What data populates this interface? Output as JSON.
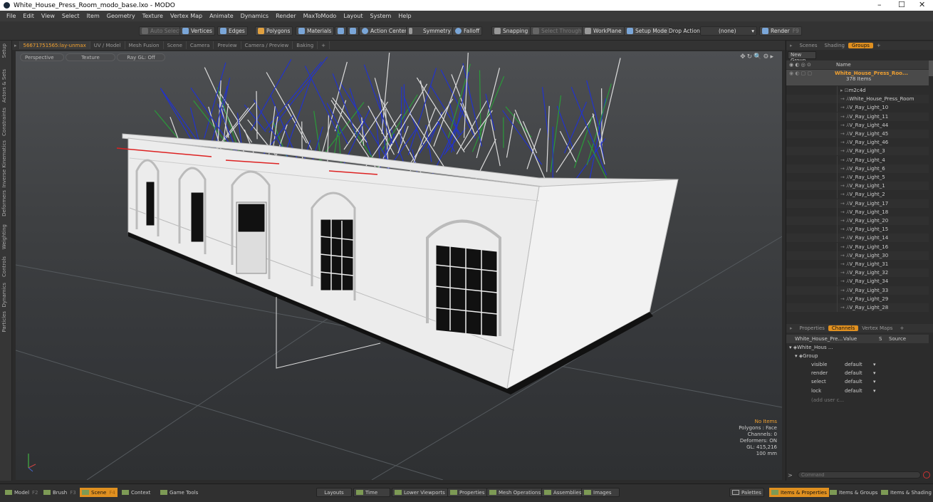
{
  "window": {
    "title": "White_House_Press_Room_modo_base.lxo - MODO",
    "minimize": "–",
    "maximize": "☐",
    "close": "✕"
  },
  "menu": [
    "File",
    "Edit",
    "View",
    "Select",
    "Item",
    "Geometry",
    "Texture",
    "Vertex Map",
    "Animate",
    "Dynamics",
    "Render",
    "MaxToModo",
    "Layout",
    "System",
    "Help"
  ],
  "toolbar": {
    "auto_select": "Auto Select",
    "vertices": "Vertices",
    "edges": "Edges",
    "polygons": "Polygons",
    "materials": "Materials",
    "action_center": "Action Center",
    "symmetry": "Symmetry",
    "falloff": "Falloff",
    "snapping": "Snapping",
    "select_through": "Select Through",
    "workplane": "WorkPlane",
    "setup_mode": "Setup Mode",
    "drop_action": "Drop Action",
    "drop_value": "(none)",
    "render": "Render",
    "render_key": "F9"
  },
  "left_tabs": [
    "Setup",
    "Actors & Sets",
    "Constraints",
    "Inverse Kinematics",
    "Deformers",
    "Weighting",
    "Controls",
    "Dynamics",
    "Particles"
  ],
  "viewport_tabs": [
    "56671751565:lay-unmax",
    "UV / Model",
    "Mesh Fusion",
    "Scene",
    "Camera",
    "Preview",
    "Camera / Preview",
    "Baking",
    "+"
  ],
  "viewport": {
    "view": "Perspective",
    "shading": "Texture",
    "raygl": "Ray GL: Off"
  },
  "hud": {
    "items": "No Items",
    "polygons": "Polygons : Face",
    "channels": "Channels: 0",
    "deformers": "Deformers: ON",
    "gl": "GL: 415,216",
    "scale": "100 mm"
  },
  "scene_tabs": [
    "Scenes",
    "Shading",
    "Groups",
    "+"
  ],
  "groups": {
    "new_group": "New Group",
    "name_col": "Name",
    "root": "White_House_Press_Roo...",
    "count": "378 Items",
    "items": [
      "m2c4d",
      "White_House_Press_Room",
      "V_Ray_Light_10",
      "V_Ray_Light_11",
      "V_Ray_Light_44",
      "V_Ray_Light_45",
      "V_Ray_Light_46",
      "V_Ray_Light_3",
      "V_Ray_Light_4",
      "V_Ray_Light_6",
      "V_Ray_Light_5",
      "V_Ray_Light_1",
      "V_Ray_Light_2",
      "V_Ray_Light_17",
      "V_Ray_Light_18",
      "V_Ray_Light_20",
      "V_Ray_Light_15",
      "V_Ray_Light_14",
      "V_Ray_Light_16",
      "V_Ray_Light_30",
      "V_Ray_Light_31",
      "V_Ray_Light_32",
      "V_Ray_Light_34",
      "V_Ray_Light_33",
      "V_Ray_Light_29",
      "V_Ray_Light_28"
    ]
  },
  "channel_tabs": [
    "Properties",
    "Channels",
    "Vertex Maps",
    "+"
  ],
  "channels": {
    "header": [
      "White_House_Pre...",
      "Value",
      "S",
      "Source"
    ],
    "item": "White_Hous ...",
    "group": "Group",
    "rows": [
      {
        "name": "visible",
        "value": "default"
      },
      {
        "name": "render",
        "value": "default"
      },
      {
        "name": "select",
        "value": "default"
      },
      {
        "name": "lock",
        "value": "default"
      }
    ],
    "add": "(add user c..."
  },
  "command": {
    "placeholder": "Command"
  },
  "bottom": {
    "model": "Model",
    "model_key": "F2",
    "brush": "Brush",
    "brush_key": "F3",
    "scene": "Scene",
    "scene_key": "F4",
    "context": "Context",
    "game_tools": "Game Tools",
    "layouts": "Layouts",
    "time": "Time",
    "lower_viewports": "Lower Viewports",
    "properties": "Properties",
    "mesh_operations": "Mesh Operations",
    "assemblies": "Assemblies",
    "images": "Images",
    "palettes": "Palettes",
    "items_properties": "Items & Properties",
    "items_groups": "Items & Groups",
    "items_shading": "Items & Shading"
  }
}
